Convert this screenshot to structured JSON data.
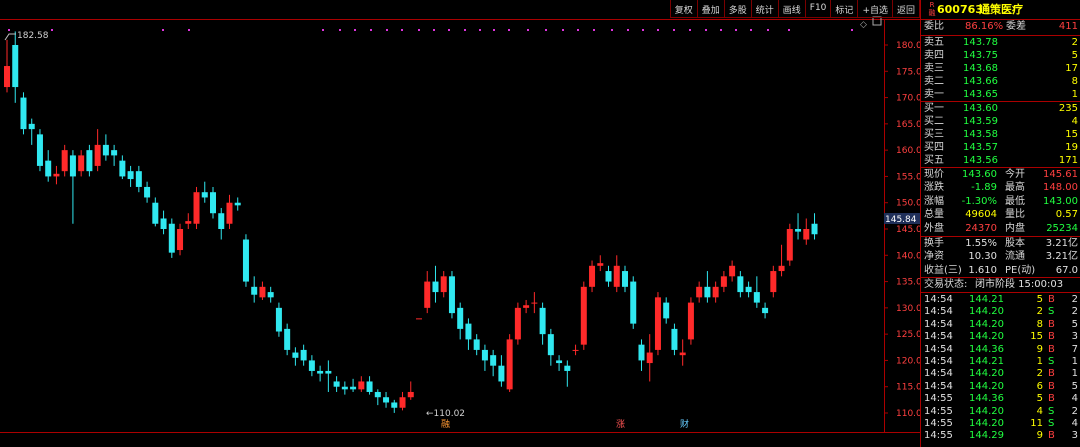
{
  "toolbar": [
    "复权",
    "叠加",
    "多股",
    "统计",
    "画线",
    "F10",
    "标记",
    "+自选",
    "返回"
  ],
  "chart": {
    "high_label": "182.58",
    "low_label": "110.02",
    "current_price_tag": "145.84",
    "event_marks": [
      {
        "text": "融",
        "color": "#ff9933"
      },
      {
        "text": "涨",
        "color": "#ff5555"
      },
      {
        "text": "财",
        "color": "#66ccff"
      }
    ]
  },
  "chart_data": {
    "type": "candlestick",
    "y_ticks": [
      "180.0",
      "175.0",
      "170.0",
      "165.0",
      "160.0",
      "155.0",
      "150.0",
      "145.0",
      "140.0",
      "135.0",
      "130.0",
      "125.0",
      "120.0",
      "115.0",
      "110.0"
    ],
    "ylim": [
      108,
      184
    ],
    "up_color": "#ff2a2a",
    "down_color": "#30e8f0",
    "candles": [
      {
        "o": 172,
        "c": 176,
        "h": 181.0,
        "l": 171.0
      },
      {
        "o": 180,
        "c": 172,
        "h": 182.58,
        "l": 169.0
      },
      {
        "o": 170,
        "c": 164,
        "h": 171,
        "l": 163
      },
      {
        "o": 165,
        "c": 164,
        "h": 166,
        "l": 161
      },
      {
        "o": 163,
        "c": 157,
        "h": 164,
        "l": 156
      },
      {
        "o": 158,
        "c": 155,
        "h": 160,
        "l": 154
      },
      {
        "o": 155,
        "c": 155.5,
        "h": 157,
        "l": 153.5
      },
      {
        "o": 156,
        "c": 160,
        "h": 161,
        "l": 155
      },
      {
        "o": 159,
        "c": 155,
        "h": 160,
        "l": 146
      },
      {
        "o": 156,
        "c": 159,
        "h": 160,
        "l": 155
      },
      {
        "o": 160,
        "c": 156,
        "h": 161,
        "l": 155
      },
      {
        "o": 157,
        "c": 161,
        "h": 164,
        "l": 156
      },
      {
        "o": 161,
        "c": 159,
        "h": 163,
        "l": 158
      },
      {
        "o": 160,
        "c": 159,
        "h": 161,
        "l": 157
      },
      {
        "o": 158,
        "c": 155,
        "h": 159,
        "l": 154.5
      },
      {
        "o": 156,
        "c": 154.5,
        "h": 157,
        "l": 153
      },
      {
        "o": 156,
        "c": 153,
        "h": 157,
        "l": 152
      },
      {
        "o": 153,
        "c": 151,
        "h": 154,
        "l": 150
      },
      {
        "o": 150,
        "c": 146,
        "h": 151,
        "l": 145.5
      },
      {
        "o": 147,
        "c": 145,
        "h": 148.5,
        "l": 144
      },
      {
        "o": 146,
        "c": 140.5,
        "h": 147,
        "l": 139.5
      },
      {
        "o": 141,
        "c": 145,
        "h": 146,
        "l": 140
      },
      {
        "o": 146,
        "c": 146.5,
        "h": 148,
        "l": 145
      },
      {
        "o": 146,
        "c": 152,
        "h": 153,
        "l": 145
      },
      {
        "o": 152,
        "c": 151,
        "h": 154,
        "l": 150
      },
      {
        "o": 152,
        "c": 148,
        "h": 153,
        "l": 147
      },
      {
        "o": 148,
        "c": 145,
        "h": 149,
        "l": 143
      },
      {
        "o": 146,
        "c": 150,
        "h": 151.5,
        "l": 145
      },
      {
        "o": 150,
        "c": 149.5,
        "h": 151,
        "l": 148.5
      },
      {
        "o": 143,
        "c": 135,
        "h": 144,
        "l": 134
      },
      {
        "o": 134,
        "c": 132.5,
        "h": 136,
        "l": 131
      },
      {
        "o": 132,
        "c": 134,
        "h": 135,
        "l": 131.5
      },
      {
        "o": 133,
        "c": 132,
        "h": 134,
        "l": 131
      },
      {
        "o": 130,
        "c": 125.5,
        "h": 131,
        "l": 124.5
      },
      {
        "o": 126,
        "c": 122,
        "h": 127,
        "l": 121
      },
      {
        "o": 121.5,
        "c": 120.5,
        "h": 122.5,
        "l": 119
      },
      {
        "o": 122,
        "c": 120,
        "h": 123,
        "l": 119
      },
      {
        "o": 120,
        "c": 118,
        "h": 121,
        "l": 117
      },
      {
        "o": 118,
        "c": 117.5,
        "h": 119,
        "l": 116
      },
      {
        "o": 118,
        "c": 117.5,
        "h": 120,
        "l": 114
      },
      {
        "o": 116,
        "c": 115,
        "h": 117,
        "l": 114
      },
      {
        "o": 115,
        "c": 114.5,
        "h": 116,
        "l": 113.5
      },
      {
        "o": 115,
        "c": 114.5,
        "h": 116.5,
        "l": 114
      },
      {
        "o": 114.5,
        "c": 116,
        "h": 117,
        "l": 114
      },
      {
        "o": 116,
        "c": 114,
        "h": 117,
        "l": 113.5
      },
      {
        "o": 114,
        "c": 113,
        "h": 114.5,
        "l": 111.5
      },
      {
        "o": 113,
        "c": 112,
        "h": 114,
        "l": 111
      },
      {
        "o": 112,
        "c": 111,
        "h": 112.5,
        "l": 110.02
      },
      {
        "o": 111,
        "c": 113,
        "h": 114,
        "l": 110.5
      },
      {
        "o": 113,
        "c": 114,
        "h": 116,
        "l": 112.5
      },
      {
        "o": 128,
        "c": 128,
        "h": 128,
        "l": 128
      },
      {
        "o": 130,
        "c": 135,
        "h": 137,
        "l": 129
      },
      {
        "o": 135,
        "c": 133,
        "h": 138,
        "l": 131
      },
      {
        "o": 133,
        "c": 136,
        "h": 137,
        "l": 132
      },
      {
        "o": 136,
        "c": 129,
        "h": 137,
        "l": 128
      },
      {
        "o": 130,
        "c": 126,
        "h": 131,
        "l": 124
      },
      {
        "o": 127,
        "c": 124,
        "h": 128,
        "l": 122
      },
      {
        "o": 124,
        "c": 122,
        "h": 125,
        "l": 121
      },
      {
        "o": 122,
        "c": 120,
        "h": 123,
        "l": 118
      },
      {
        "o": 121,
        "c": 119,
        "h": 122,
        "l": 117
      },
      {
        "o": 119,
        "c": 116,
        "h": 121,
        "l": 115
      },
      {
        "o": 114.5,
        "c": 124,
        "h": 125,
        "l": 114
      },
      {
        "o": 124,
        "c": 130,
        "h": 131,
        "l": 123
      },
      {
        "o": 130,
        "c": 130.5,
        "h": 131.5,
        "l": 129
      },
      {
        "o": 131,
        "c": 131,
        "h": 133,
        "l": 129
      },
      {
        "o": 130,
        "c": 125,
        "h": 131,
        "l": 123
      },
      {
        "o": 125,
        "c": 121,
        "h": 126,
        "l": 119
      },
      {
        "o": 120,
        "c": 119.5,
        "h": 121,
        "l": 118
      },
      {
        "o": 119,
        "c": 118,
        "h": 120,
        "l": 115
      },
      {
        "o": 122,
        "c": 122,
        "h": 123,
        "l": 121
      },
      {
        "o": 123,
        "c": 134,
        "h": 135,
        "l": 122
      },
      {
        "o": 134,
        "c": 138,
        "h": 139,
        "l": 133
      },
      {
        "o": 138,
        "c": 138.5,
        "h": 140,
        "l": 137
      },
      {
        "o": 137,
        "c": 135,
        "h": 138,
        "l": 134
      },
      {
        "o": 134,
        "c": 138,
        "h": 140,
        "l": 133
      },
      {
        "o": 137,
        "c": 134,
        "h": 138,
        "l": 133
      },
      {
        "o": 135,
        "c": 127,
        "h": 136,
        "l": 126
      },
      {
        "o": 123,
        "c": 120,
        "h": 124,
        "l": 118
      },
      {
        "o": 119.5,
        "c": 121.5,
        "h": 125,
        "l": 116
      },
      {
        "o": 122,
        "c": 132,
        "h": 133,
        "l": 121
      },
      {
        "o": 131,
        "c": 128,
        "h": 132,
        "l": 127
      },
      {
        "o": 126,
        "c": 122,
        "h": 127,
        "l": 121
      },
      {
        "o": 121,
        "c": 121.5,
        "h": 124,
        "l": 119
      },
      {
        "o": 124,
        "c": 131,
        "h": 132,
        "l": 123
      },
      {
        "o": 132,
        "c": 134,
        "h": 135,
        "l": 131
      },
      {
        "o": 134,
        "c": 132,
        "h": 137,
        "l": 131
      },
      {
        "o": 132,
        "c": 134,
        "h": 135,
        "l": 131
      },
      {
        "o": 134,
        "c": 136,
        "h": 137,
        "l": 133
      },
      {
        "o": 136,
        "c": 138,
        "h": 139,
        "l": 135
      },
      {
        "o": 136,
        "c": 133,
        "h": 137,
        "l": 132
      },
      {
        "o": 134,
        "c": 133,
        "h": 135,
        "l": 132
      },
      {
        "o": 133,
        "c": 131,
        "h": 136,
        "l": 130
      },
      {
        "o": 130,
        "c": 129,
        "h": 131,
        "l": 128
      },
      {
        "o": 133,
        "c": 137,
        "h": 138,
        "l": 132
      },
      {
        "o": 137,
        "c": 138,
        "h": 142,
        "l": 136
      },
      {
        "o": 139,
        "c": 145,
        "h": 146,
        "l": 138
      },
      {
        "o": 145,
        "c": 144.5,
        "h": 148,
        "l": 143
      },
      {
        "o": 143,
        "c": 145,
        "h": 147,
        "l": 142
      },
      {
        "o": 146,
        "c": 144,
        "h": 148,
        "l": 143
      }
    ]
  },
  "quote": {
    "badge_top": "R",
    "badge_bottom": "融",
    "code": "600763",
    "name": "通策医疗",
    "weibi_label": "委比",
    "weibi_value": "86.16%",
    "weicha_label": "委差",
    "weicha_value": "411",
    "asks": [
      {
        "label": "卖五",
        "price": "143.78",
        "vol": "2"
      },
      {
        "label": "卖四",
        "price": "143.75",
        "vol": "5"
      },
      {
        "label": "卖三",
        "price": "143.68",
        "vol": "17"
      },
      {
        "label": "卖二",
        "price": "143.66",
        "vol": "8"
      },
      {
        "label": "卖一",
        "price": "143.65",
        "vol": "1"
      }
    ],
    "bids": [
      {
        "label": "买一",
        "price": "143.60",
        "vol": "235"
      },
      {
        "label": "买二",
        "price": "143.59",
        "vol": "4"
      },
      {
        "label": "买三",
        "price": "143.58",
        "vol": "15"
      },
      {
        "label": "买四",
        "price": "143.57",
        "vol": "19"
      },
      {
        "label": "买五",
        "price": "143.56",
        "vol": "171"
      }
    ],
    "stats": [
      {
        "l1": "现价",
        "v1": "143.60",
        "c1": "green",
        "l2": "今开",
        "v2": "145.61",
        "c2": "red"
      },
      {
        "l1": "涨跌",
        "v1": "-1.89",
        "c1": "green",
        "l2": "最高",
        "v2": "148.00",
        "c2": "red"
      },
      {
        "l1": "涨幅",
        "v1": "-1.30%",
        "c1": "green",
        "l2": "最低",
        "v2": "143.00",
        "c2": "green"
      },
      {
        "l1": "总量",
        "v1": "49604",
        "c1": "yellow",
        "l2": "量比",
        "v2": "0.57",
        "c2": "yellow"
      },
      {
        "l1": "外盘",
        "v1": "24370",
        "c1": "red",
        "l2": "内盘",
        "v2": "25234",
        "c2": "green"
      }
    ],
    "stats2": [
      {
        "l1": "换手",
        "v1": "1.55%",
        "l2": "股本",
        "v2": "3.21亿"
      },
      {
        "l1": "净资",
        "v1": "10.30",
        "l2": "流通",
        "v2": "3.21亿"
      },
      {
        "l1": "收益(三)",
        "v1": "1.610",
        "l2": "PE(动)",
        "v2": "67.0"
      }
    ],
    "status_label": "交易状态:",
    "status_value": "闭市阶段 15:00:03",
    "ticks": [
      {
        "time": "14:54",
        "price": "144.21",
        "pc": "green",
        "vol": "5",
        "bs": "B",
        "n": "2"
      },
      {
        "time": "14:54",
        "price": "144.20",
        "pc": "green",
        "vol": "2",
        "bs": "S",
        "n": "2"
      },
      {
        "time": "14:54",
        "price": "144.20",
        "pc": "green",
        "vol": "8",
        "bs": "B",
        "n": "5"
      },
      {
        "time": "14:54",
        "price": "144.20",
        "pc": "green",
        "vol": "15",
        "bs": "B",
        "n": "3"
      },
      {
        "time": "14:54",
        "price": "144.36",
        "pc": "green",
        "vol": "9",
        "bs": "B",
        "n": "7"
      },
      {
        "time": "14:54",
        "price": "144.21",
        "pc": "green",
        "vol": "1",
        "bs": "S",
        "n": "1"
      },
      {
        "time": "14:54",
        "price": "144.20",
        "pc": "green",
        "vol": "2",
        "bs": "B",
        "n": "1"
      },
      {
        "time": "14:54",
        "price": "144.20",
        "pc": "green",
        "vol": "6",
        "bs": "B",
        "n": "5"
      },
      {
        "time": "14:55",
        "price": "144.36",
        "pc": "green",
        "vol": "5",
        "bs": "B",
        "n": "4"
      },
      {
        "time": "14:55",
        "price": "144.20",
        "pc": "green",
        "vol": "4",
        "bs": "S",
        "n": "2"
      },
      {
        "time": "14:55",
        "price": "144.20",
        "pc": "green",
        "vol": "11",
        "bs": "S",
        "n": "4"
      },
      {
        "time": "14:55",
        "price": "144.29",
        "pc": "green",
        "vol": "9",
        "bs": "B",
        "n": "3"
      }
    ]
  }
}
